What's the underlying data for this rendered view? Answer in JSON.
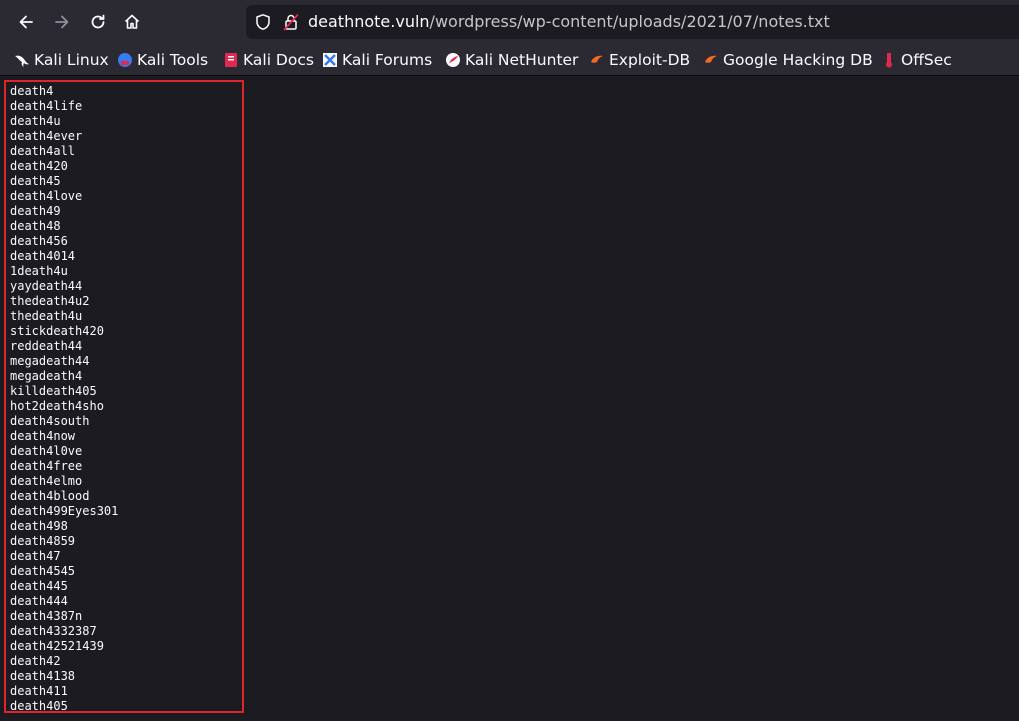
{
  "toolbar": {
    "url_domain": "deathnote.vuln",
    "url_path": "/wordpress/wp-content/uploads/2021/07/notes.txt"
  },
  "bookmarks": [
    {
      "label": "Kali Linux",
      "icon": "kali-dragon-icon"
    },
    {
      "label": "Kali Tools",
      "icon": "kali-tools-icon"
    },
    {
      "label": "Kali Docs",
      "icon": "kali-docs-icon"
    },
    {
      "label": "Kali Forums",
      "icon": "kali-forums-icon"
    },
    {
      "label": "Kali NetHunter",
      "icon": "nethunter-icon"
    },
    {
      "label": "Exploit-DB",
      "icon": "exploit-db-icon"
    },
    {
      "label": "Google Hacking DB",
      "icon": "ghdb-icon"
    },
    {
      "label": "OffSec",
      "icon": "offsec-icon"
    }
  ],
  "file": {
    "lines": [
      "death4",
      "death4life",
      "death4u",
      "death4ever",
      "death4all",
      "death420",
      "death45",
      "death4love",
      "death49",
      "death48",
      "death456",
      "death4014",
      "1death4u",
      "yaydeath44",
      "thedeath4u2",
      "thedeath4u",
      "stickdeath420",
      "reddeath44",
      "megadeath44",
      "megadeath4",
      "killdeath405",
      "hot2death4sho",
      "death4south",
      "death4now",
      "death4l0ve",
      "death4free",
      "death4elmo",
      "death4blood",
      "death499Eyes301",
      "death498",
      "death4859",
      "death47",
      "death4545",
      "death445",
      "death444",
      "death4387n",
      "death4332387",
      "death42521439",
      "death42",
      "death4138",
      "death411",
      "death405"
    ]
  },
  "colors": {
    "toolbar_bg": "#2b2a33",
    "page_bg": "#1c1b22",
    "text": "#fbfbfe",
    "highlight": "#e0242b"
  }
}
